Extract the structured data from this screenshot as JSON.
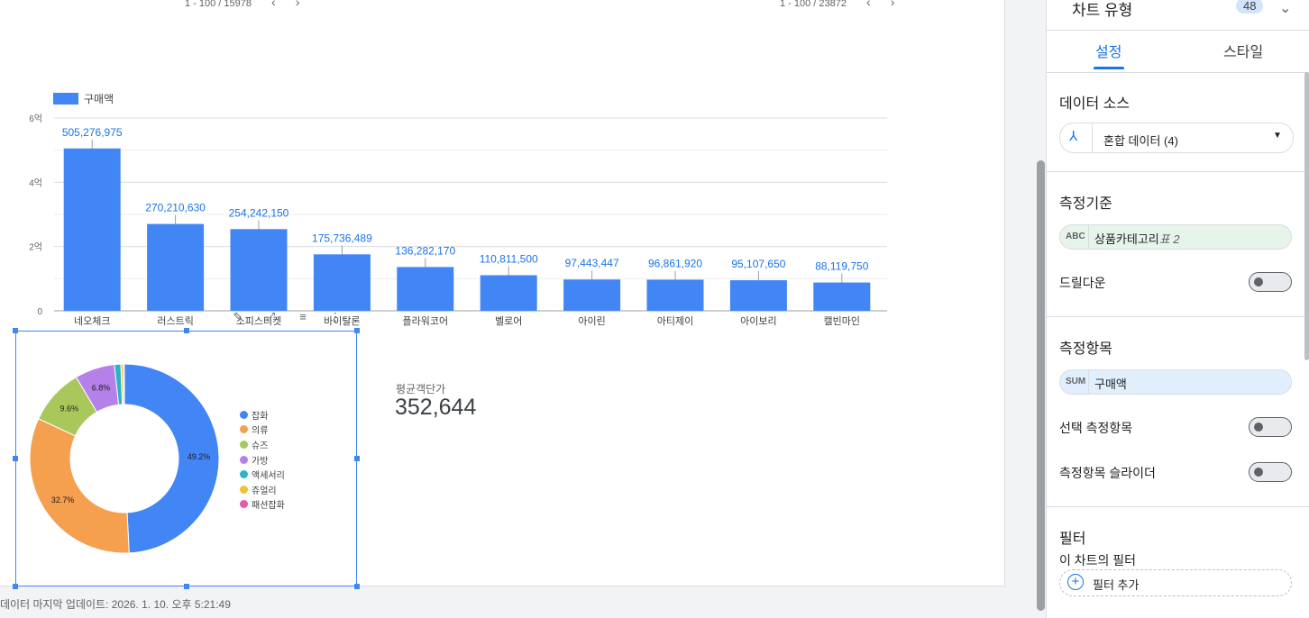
{
  "pager_left": "1 - 100 / 15978",
  "pager_right": "1 - 100 / 23872",
  "pager_prev": "‹",
  "pager_next": "›",
  "bar_legend": "구매액",
  "footer": "데이터 마지막 업데이트: 2026. 1. 10. 오후 5:21:49",
  "toolbar": {
    "edit": "✎",
    "expand": "⤢",
    "filter": "≡",
    "more": "⋮"
  },
  "kpi": {
    "label": "평균객단가",
    "value": "352,644"
  },
  "colors": {
    "bar": "#4285f4",
    "accent": "#1a73e8"
  },
  "chart_data": [
    {
      "type": "bar",
      "categories": [
        "네오체크",
        "러스트릭",
        "소피스티켓",
        "바이탈론",
        "플라워코어",
        "벨로어",
        "아이린",
        "아티제이",
        "아이보리",
        "캘빈마인"
      ],
      "series": [
        {
          "name": "구매액",
          "values": [
            505276975,
            270210630,
            254242150,
            175736489,
            136282170,
            110811500,
            97443447,
            96861920,
            95107650,
            88119750
          ]
        }
      ],
      "data_labels": [
        "505,276,975",
        "270,210,630",
        "254,242,150",
        "175,736,489",
        "136,282,170",
        "110,811,500",
        "97,443,447",
        "96,861,920",
        "95,107,650",
        "88,119,750"
      ],
      "yticks": [
        "0",
        "2억",
        "4억",
        "6억"
      ],
      "ylim": [
        0,
        600000000
      ],
      "grid": true,
      "legend_position": "top-left"
    },
    {
      "type": "pie",
      "donut": true,
      "labels": [
        "잡화",
        "의류",
        "슈즈",
        "가방",
        "액세서리",
        "쥬얼리",
        "패션잡화"
      ],
      "values": [
        49.2,
        32.7,
        9.6,
        6.8,
        1.1,
        0.4,
        0.2
      ],
      "value_labels": [
        "49.2%",
        "32.7%",
        "9.6%",
        "6.8%",
        "",
        "",
        ""
      ],
      "colors": [
        "#4285f4",
        "#f4a04f",
        "#a9c75b",
        "#b580e8",
        "#2ab3c6",
        "#f1c232",
        "#e85aa5"
      ],
      "legend_position": "right"
    }
  ],
  "panel": {
    "chart_type_label": "차트 유형",
    "badge": "48",
    "chevron": "⌄",
    "tabs": [
      "설정",
      "스타일"
    ],
    "data_source_title": "데이터 소스",
    "data_source_value": "혼합 데이터 (4)",
    "data_source_icon": "⅄",
    "dropdown_arrow": "▼",
    "dimension_title": "측정기준",
    "dimension_type": "ABC",
    "dimension_name": "상품카테고리",
    "dimension_suffix": "표 2",
    "drilldown_label": "드릴다운",
    "metric_title": "측정항목",
    "metric_type": "SUM",
    "metric_name": "구매액",
    "optional_metric_label": "선택 측정항목",
    "metric_slider_label": "측정항목 슬라이더",
    "filter_title": "필터",
    "filter_sub": "이 차트의 필터",
    "add_filter_icon": "+",
    "add_filter_label": "필터 추가"
  }
}
